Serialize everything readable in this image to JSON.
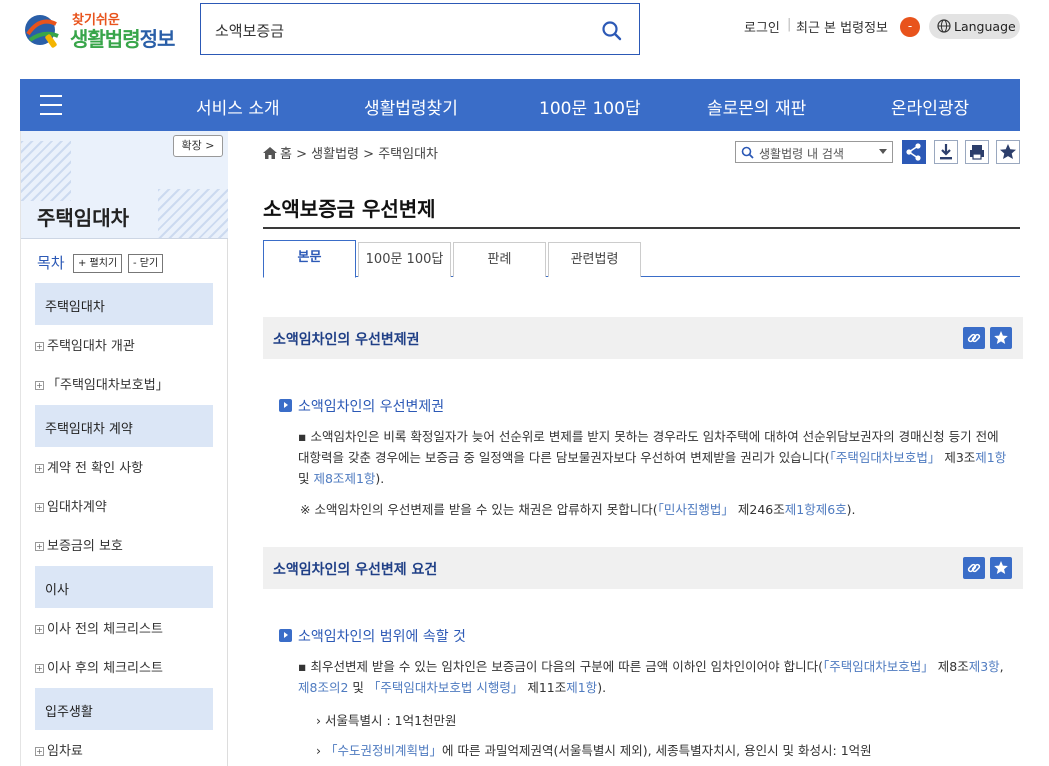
{
  "header": {
    "logo_small": "찾기쉬운",
    "logo_big_1": "생활법령",
    "logo_big_2": "정보",
    "search_value": "소액보증금",
    "login": "로그인",
    "separator": "|",
    "recent": "최근 본 법령정보",
    "recent_badge": "-",
    "language": "Language"
  },
  "nav": {
    "items": [
      "서비스 소개",
      "생활법령찾기",
      "100문 100답",
      "솔로몬의 재판",
      "온라인광장"
    ]
  },
  "sidebar": {
    "expand": "확장 >",
    "title": "주택임대차",
    "toc_label": "목차",
    "expand_all": "+ 펼치기",
    "collapse_all": "- 닫기",
    "sections": [
      {
        "label": "주택임대차",
        "items": [
          "주택임대차 개관",
          "「주택임대차보호법」"
        ]
      },
      {
        "label": "주택임대차 계약",
        "items": [
          "계약 전 확인 사항",
          "임대차계약",
          "보증금의 보호"
        ]
      },
      {
        "label": "이사",
        "items": [
          "이사 전의 체크리스트",
          "이사 후의 체크리스트"
        ]
      },
      {
        "label": "입주생활",
        "items": [
          "임차료"
        ]
      }
    ]
  },
  "breadcrumb": {
    "home": "홈",
    "sep": ">",
    "level1": "생활법령",
    "level2": "주택임대차"
  },
  "law_search": {
    "placeholder": "생활법령 내 검색"
  },
  "page": {
    "title": "소액보증금 우선변제"
  },
  "tabs": [
    "본문",
    "100문 100답",
    "판례",
    "관련법령"
  ],
  "sections": [
    {
      "title": "소액임차인의 우선변제권",
      "sub_title": "소액임차인의 우선변제권",
      "para_1": "소액임차인은 비록 확정일자가 늦어 선순위로 변제를 받지 못하는 경우라도 임차주택에 대하여 선순위담보권자의 경매신청 등기 전에 대항력을 갖춘 경우에는 보증금 중 일정액을 다른 담보물권자보다 우선하여 변제받을 권리가 있습니다(",
      "para_1_link_1": "「주택임대차보호법」",
      "para_1_mid_1": " 제3조",
      "para_1_link_2": "제1항",
      "para_1_mid_2": " 및 ",
      "para_1_link_3": "제8조",
      "para_1_link_4": "제1항",
      "para_1_end": ").",
      "note_text": "※ 소액임차인의 우선변제를 받을 수 있는 채권은 압류하지 못합니다(",
      "note_link_1": "「민사집행법」",
      "note_mid": " 제246조",
      "note_link_2": "제1항제6호",
      "note_end": ")."
    },
    {
      "title": "소액임차인의 우선변제 요건",
      "sub_title": "소액임차인의 범위에 속할 것",
      "para_1": "최우선변제 받을 수 있는 임차인은 보증금이 다음의 구분에 따른 금액 이하인 임차인이어야 합니다(",
      "para_1_link_1": "「주택임대차보호법」",
      "para_1_mid_1": " 제8조",
      "para_1_link_2": "제3항",
      "para_1_mid_2": ", ",
      "para_1_link_3": "제8조의2",
      "para_1_mid_3": " 및 ",
      "para_1_link_4": "「주택임대차보호법 시행령」",
      "para_1_mid_4": " 제11조",
      "para_1_link_5": "제1항",
      "para_1_end": ").",
      "item_1": "서울특별시 : 1억1천만원",
      "item_2_link": "「수도권정비계획법」",
      "item_2_text": "에 따른 과밀억제권역(서울특별시 제외), 세종특별자치시, 용인시 및 화성시: 1억원"
    }
  ],
  "colors": {
    "brand_blue": "#3a6dc8",
    "accent_orange": "#e8531c",
    "link_blue": "#4f7bc0"
  }
}
